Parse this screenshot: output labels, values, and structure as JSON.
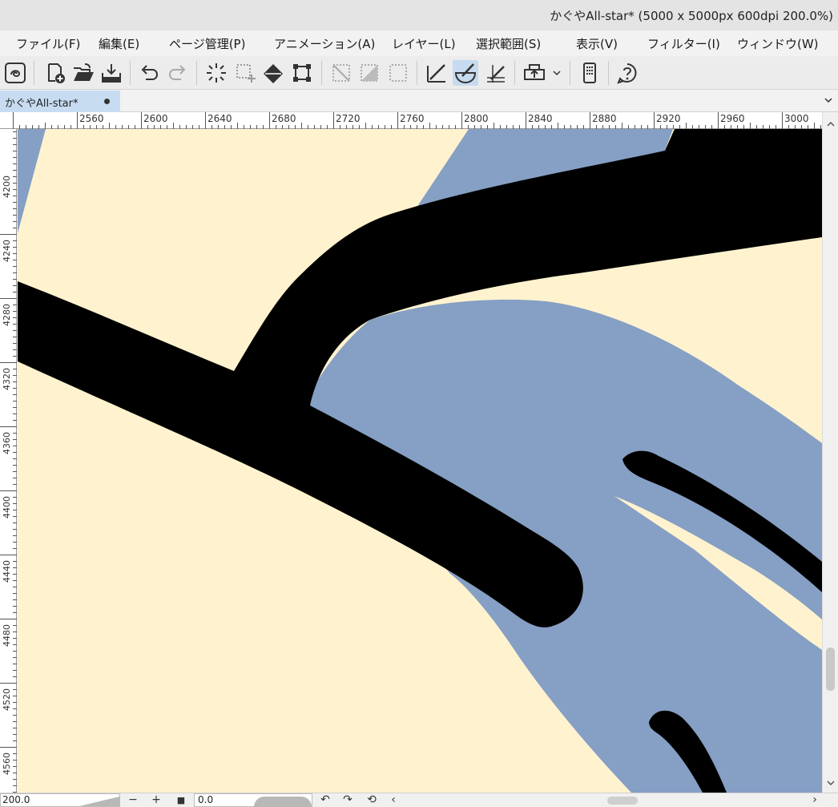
{
  "window": {
    "title": "かぐやAll-star* (5000 x 5000px 600dpi 200.0%)"
  },
  "menu": {
    "items": [
      "ファイル(F)",
      "編集(E)",
      "ページ管理(P)",
      "アニメーション(A)",
      "レイヤー(L)",
      "選択範囲(S)",
      "表示(V)",
      "フィルター(I)",
      "ウィンドウ(W)"
    ]
  },
  "toolbar": {
    "icons": [
      "clip-studio-logo-icon",
      "new-file-icon",
      "open-folder-icon",
      "save-icon",
      "undo-icon",
      "redo-icon",
      "clear-selection-icon",
      "deselect-icon",
      "fill-icon",
      "transform-icon",
      "hide-selection-icon",
      "invert-selection-icon",
      "select-all-icon",
      "snap-to-ruler-icon",
      "snap-to-special-ruler-icon",
      "snap-to-grid-icon",
      "export-icon",
      "companion-mode-icon",
      "help-icon"
    ],
    "active_icon": "snap-to-special-ruler-icon"
  },
  "tabs": {
    "document_label": "かぐやAll-star*",
    "document_unsaved_marker": "●"
  },
  "rulers": {
    "top_labels": [
      "2560",
      "2600",
      "2640",
      "2680",
      "2720",
      "2760",
      "2800",
      "2840",
      "2880",
      "2920",
      "2960",
      "3000"
    ],
    "left_labels": [
      "4200",
      "4240",
      "4280",
      "4320",
      "4360",
      "4400",
      "4440",
      "4480",
      "4520",
      "4560"
    ]
  },
  "canvas": {
    "colors": {
      "background": "#fff3cf",
      "blue_fill": "#869fc4",
      "line": "#000000"
    }
  },
  "statusbar": {
    "zoom_value": "200.0",
    "rotation_value": "0.0",
    "zoom_out_label": "−",
    "zoom_in_label": "+",
    "fit_label": "■",
    "rotate_left_label": "↶",
    "rotate_right_label": "↷",
    "reset_rotation_label": "⟲",
    "scroll_left_label": "‹",
    "scroll_right_label": "›"
  }
}
